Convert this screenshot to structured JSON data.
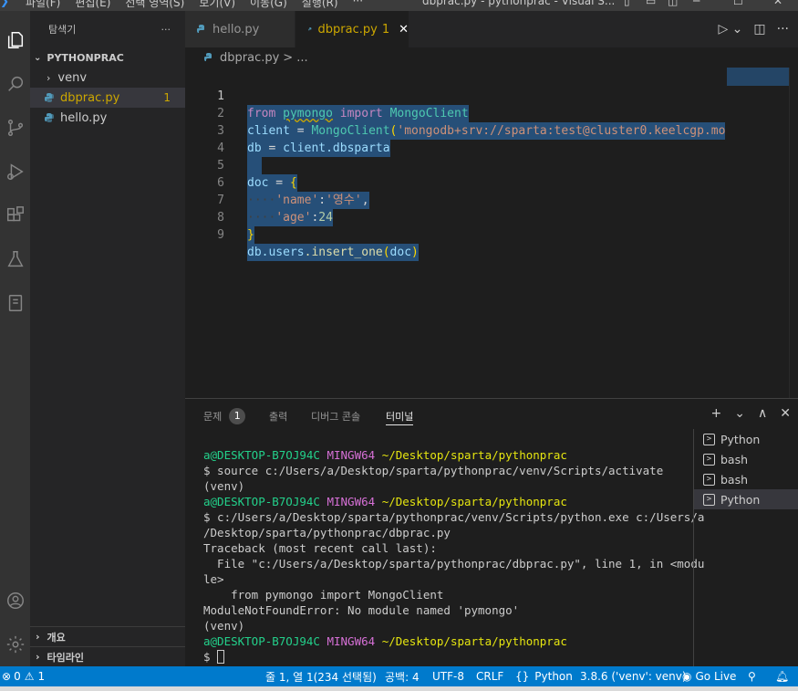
{
  "titlebar": {
    "menu": [
      "파일(F)",
      "편집(E)",
      "선택 영역(S)",
      "보기(V)",
      "이동(G)",
      "실행(R)",
      "···"
    ],
    "title": "dbprac.py - pythonprac - Visual S..."
  },
  "sidebar": {
    "title": "탐색기",
    "more": "···",
    "folder": "PYTHONPRAC",
    "items": [
      {
        "label": "venv",
        "type": "folder"
      },
      {
        "label": "dbprac.py",
        "type": "file",
        "problems": "1"
      },
      {
        "label": "hello.py",
        "type": "file"
      }
    ],
    "outline": "개요",
    "timeline": "타임라인"
  },
  "tabs": [
    {
      "label": "hello.py"
    },
    {
      "label": "dbprac.py",
      "problems": "1",
      "close": "✕"
    }
  ],
  "breadcrumb": {
    "file": "dbprac.py",
    "sep": ">",
    "rest": "..."
  },
  "editor": {
    "line_numbers": [
      "1",
      "2",
      "3",
      "4",
      "5",
      "6",
      "7",
      "8",
      "9"
    ],
    "code": {
      "l1_from": "from",
      "l1_mod": "pymongo",
      "l1_import": "import",
      "l1_cls": "MongoClient",
      "l2_var": "client",
      "l2_eq": " = ",
      "l2_cls": "MongoClient",
      "l2_open": "(",
      "l2_str": "'mongodb+srv://sparta:test@cluster0.keelcgp.mo",
      "l3_var": "db",
      "l3_eq": " = ",
      "l3_obj": "client",
      "l3_attr": ".dbsparta",
      "l5_var": "doc",
      "l5_eq": " = ",
      "l5_brace": "{",
      "l6_ws": "····",
      "l6_key": "'name'",
      "l6_colon": ":",
      "l6_val": "'영수'",
      "l6_comma": ",",
      "l7_ws": "····",
      "l7_key": "'age'",
      "l7_colon": ":",
      "l7_val": "24",
      "l8_brace": "}",
      "l9_db": "db",
      "l9_users": ".users",
      "l9_fn": ".insert_one",
      "l9_open": "(",
      "l9_arg": "doc",
      "l9_close": ")"
    }
  },
  "panel": {
    "tabs": [
      "문제",
      "출력",
      "디버그 콘솔",
      "터미널"
    ],
    "problems_count": "1",
    "actions": [
      "+",
      "⌄",
      "∧",
      "✕"
    ],
    "terminal": {
      "prompt_user": "a@DESKTOP-B7OJ94C",
      "prompt_env": "MINGW64",
      "prompt_path": "~/Desktop/sparta/pythonprac",
      "cmd1": "$ source c:/Users/a/Desktop/sparta/pythonprac/venv/Scripts/activate",
      "venv": "(venv)",
      "cmd2a": "$ c:/Users/a/Desktop/sparta/pythonprac/venv/Scripts/python.exe c:/Users/a",
      "cmd2b": "/Desktop/sparta/pythonprac/dbprac.py",
      "tb1": "Traceback (most recent call last):",
      "tb2": "  File \"c:/Users/a/Desktop/sparta/pythonprac/dbprac.py\", line 1, in <modu",
      "tb3": "le>",
      "tb4": "    from pymongo import MongoClient",
      "tb5": "ModuleNotFoundError: No module named 'pymongo'",
      "prompt_last": "$ "
    },
    "terminal_list": [
      "Python",
      "bash",
      "bash",
      "Python"
    ]
  },
  "statusbar": {
    "errors": "0",
    "warnings": "1",
    "position": "줄 1, 열 1(234 선택됨)",
    "spaces": "공백: 4",
    "encoding": "UTF-8",
    "eol": "CRLF",
    "language": "Python",
    "interpreter": "3.8.6 ('venv': venv)",
    "golive": "Go Live"
  },
  "colors": {
    "accent": "#007acc",
    "warning": "#cca700",
    "selection": "#264f78"
  }
}
